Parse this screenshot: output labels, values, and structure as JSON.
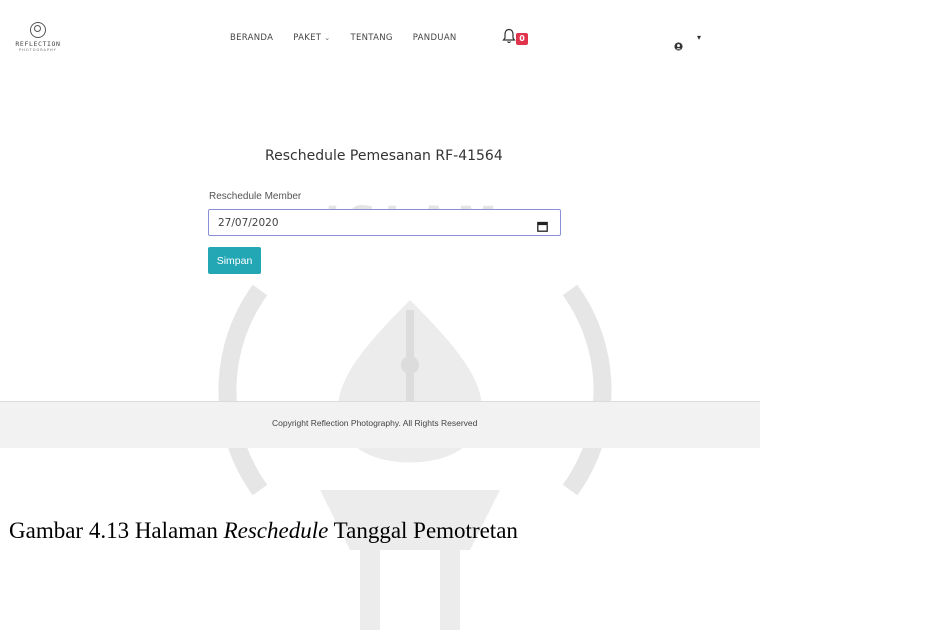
{
  "brand": {
    "name": "REFLECTION",
    "tagline": "PHOTOGRAPHY"
  },
  "nav": {
    "items": [
      {
        "label": "BERANDA"
      },
      {
        "label": "PAKET",
        "has_dropdown": true
      },
      {
        "label": "TENTANG"
      },
      {
        "label": "PANDUAN"
      }
    ],
    "notification_count": "0",
    "notification_icon": "bell-icon",
    "user_icon": "user-circle-icon"
  },
  "form": {
    "title": "Reschedule Pemesanan RF-41564",
    "label": "Reschedule Member",
    "date_value": "27/07/2020",
    "save_label": "Simpan"
  },
  "footer": {
    "text": "Copyright Reflection Photography. All Rights Reserved"
  },
  "caption": {
    "prefix": "Gambar 4.13 Halaman ",
    "italic": "Reschedule",
    "suffix": " Tanggal Pemotretan"
  },
  "colors": {
    "accent": "#23a7b5",
    "badge": "#e0334c",
    "input_border": "#8a8fd9",
    "footer_bg": "#f2f2f2"
  }
}
